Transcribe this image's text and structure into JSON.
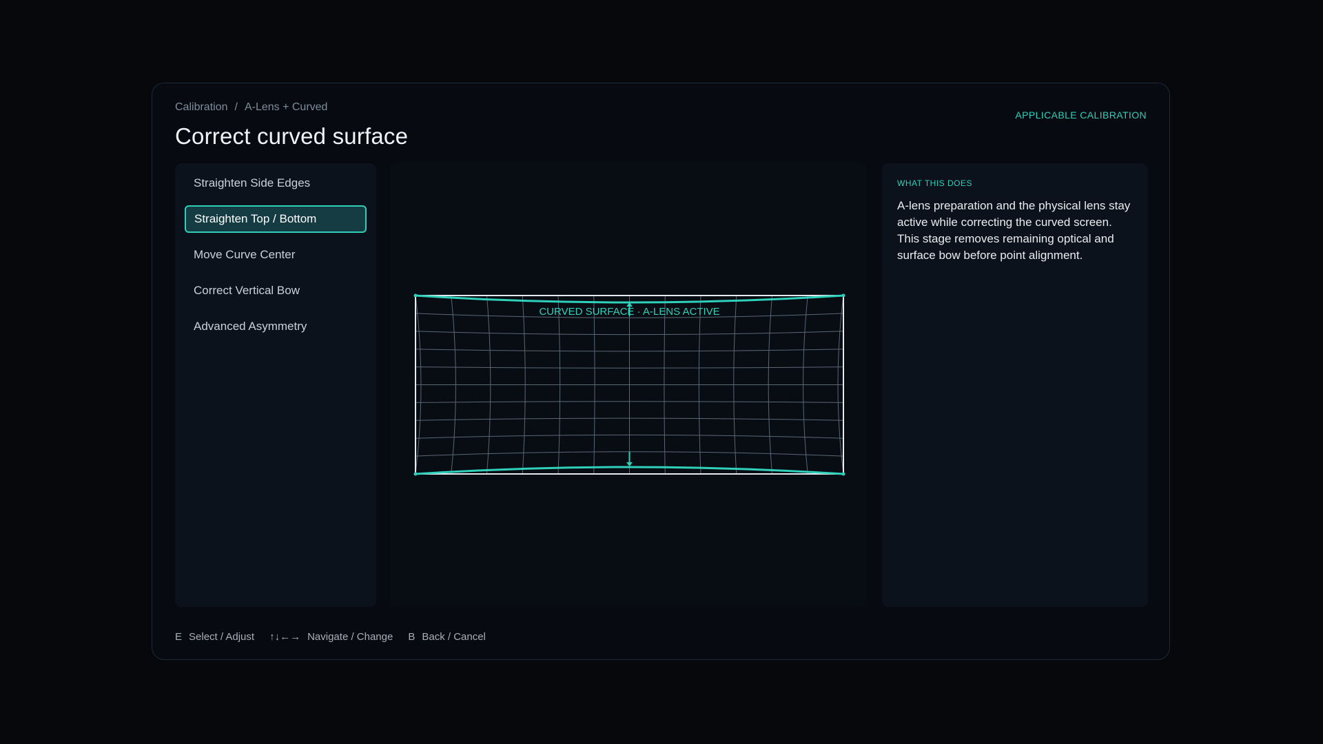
{
  "breadcrumb": {
    "items": [
      "Calibration",
      "A-Lens + Curved"
    ],
    "separator": "/"
  },
  "title": "Correct curved surface",
  "tag": "APPLICABLE CALIBRATION",
  "menu": {
    "items": [
      {
        "label": "Straighten Side Edges",
        "selected": false
      },
      {
        "label": "Straighten Top / Bottom",
        "selected": true
      },
      {
        "label": "Move Curve Center",
        "selected": false
      },
      {
        "label": "Correct Vertical Bow",
        "selected": false
      },
      {
        "label": "Advanced Asymmetry",
        "selected": false
      }
    ]
  },
  "preview": {
    "label": "CURVED SURFACE · A-LENS ACTIVE"
  },
  "info": {
    "heading": "WHAT THIS DOES",
    "body": "A-lens preparation and the physical lens stay active while correcting the curved screen. This stage removes remaining optical and surface bow before point alignment."
  },
  "hints": [
    {
      "key": "E",
      "label": "Select / Adjust"
    },
    {
      "key": "↑↓←→",
      "label": "Navigate / Change"
    },
    {
      "key": "B",
      "label": "Back / Cancel"
    }
  ],
  "colors": {
    "accent": "#2fd1bb",
    "background": "#06080c",
    "panel": "#0b121b",
    "grid": "#5b6776",
    "frame": "#e6ebf0"
  }
}
